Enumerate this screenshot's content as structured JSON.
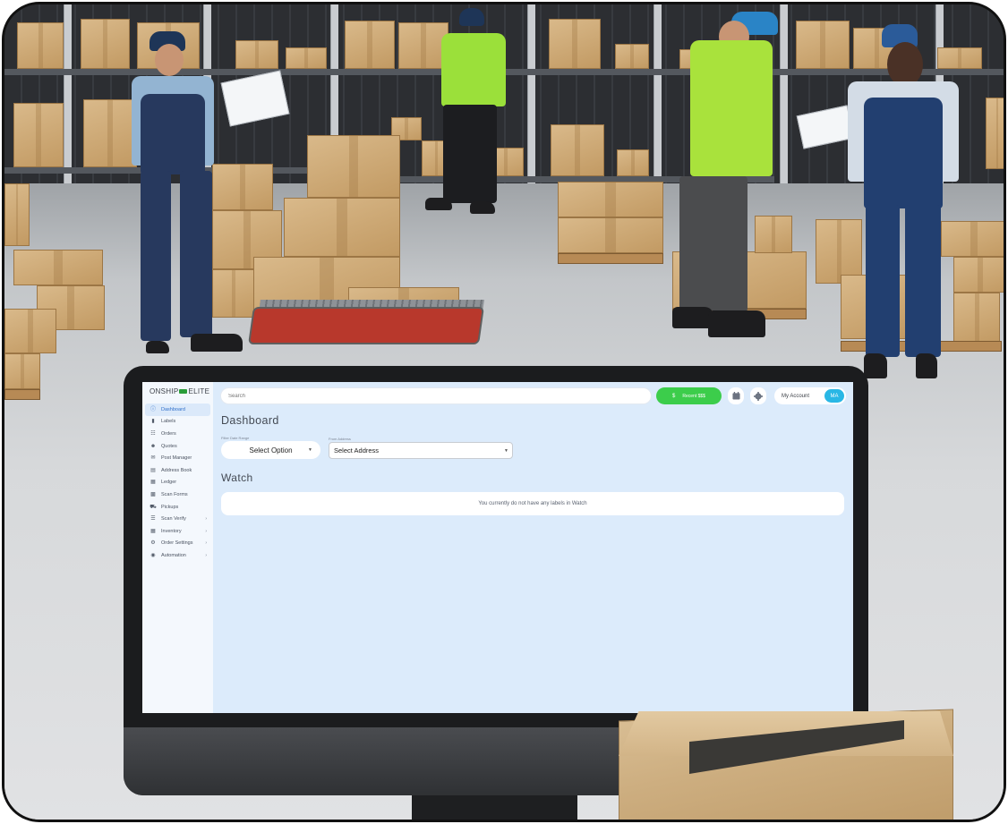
{
  "app": {
    "logo_left": "ONSHIP",
    "logo_right": "ELITE"
  },
  "sidebar": {
    "items": [
      {
        "label": "Dashboard",
        "icon": "info-circle-icon",
        "active": true,
        "has_submenu": false
      },
      {
        "label": "Labels",
        "icon": "label-icon",
        "active": false,
        "has_submenu": false
      },
      {
        "label": "Orders",
        "icon": "clipboard-icon",
        "active": false,
        "has_submenu": false
      },
      {
        "label": "Quotes",
        "icon": "people-icon",
        "active": false,
        "has_submenu": false
      },
      {
        "label": "Post Manager",
        "icon": "mailbox-icon",
        "active": false,
        "has_submenu": false
      },
      {
        "label": "Address Book",
        "icon": "book-icon",
        "active": false,
        "has_submenu": false
      },
      {
        "label": "Ledger",
        "icon": "ledger-icon",
        "active": false,
        "has_submenu": false
      },
      {
        "label": "Scan Forms",
        "icon": "scan-form-icon",
        "active": false,
        "has_submenu": false
      },
      {
        "label": "Pickups",
        "icon": "truck-icon",
        "active": false,
        "has_submenu": false
      },
      {
        "label": "Scan Verify",
        "icon": "barcode-icon",
        "active": false,
        "has_submenu": true
      },
      {
        "label": "Inventory",
        "icon": "inventory-icon",
        "active": false,
        "has_submenu": true
      },
      {
        "label": "Order Settings",
        "icon": "sliders-icon",
        "active": false,
        "has_submenu": true
      },
      {
        "label": "Automation",
        "icon": "robot-icon",
        "active": false,
        "has_submenu": true
      }
    ]
  },
  "header": {
    "search_placeholder": "Search",
    "add_funds_label": "Recent $$$",
    "add_funds_symbol": "$",
    "account_label": "My Account",
    "avatar_initials": "MA"
  },
  "main": {
    "page_title": "Dashboard",
    "filter_date_label": "Filter Date Range",
    "filter_date_value": "Select Option",
    "from_address_label": "From Address",
    "from_address_value": "Select Address",
    "watch_title": "Watch",
    "watch_empty_text": "You currently do not have any labels in Watch"
  },
  "colors": {
    "accent": "#2f6fca",
    "add_funds_button": "#3ccd4b",
    "avatar": "#29b7e5",
    "screen_background": "#dcebfb"
  }
}
